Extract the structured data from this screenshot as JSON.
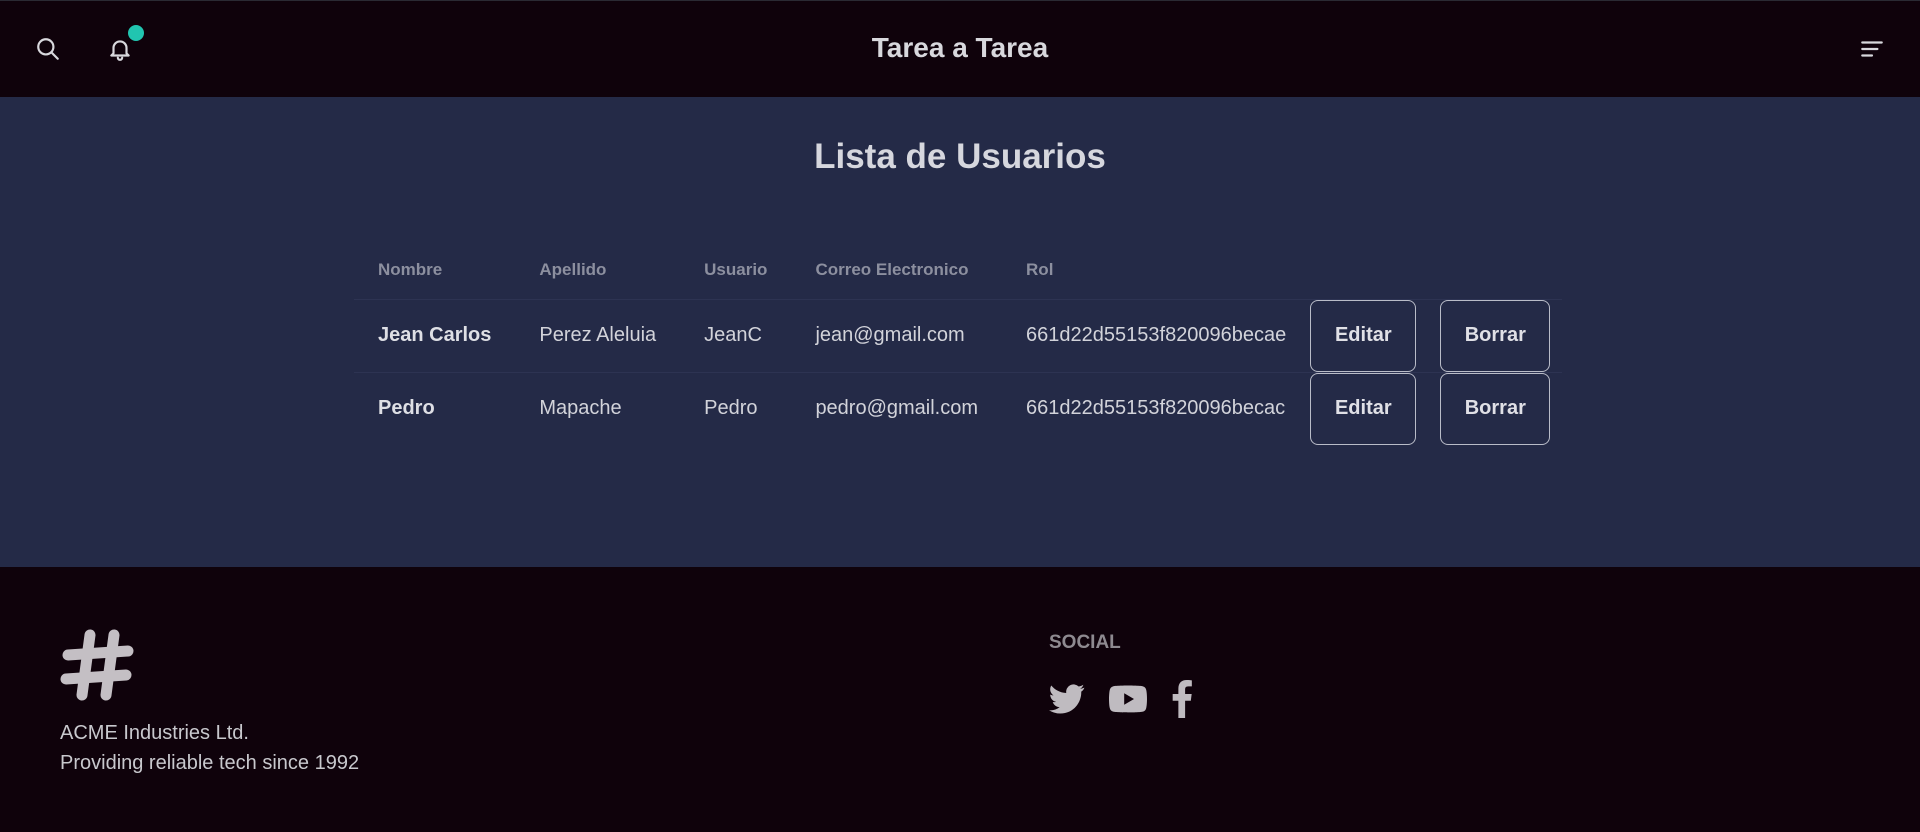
{
  "navbar": {
    "brand": "Tarea a Tarea",
    "icons": [
      "search-icon",
      "bell-icon",
      "menu-icon"
    ],
    "badge_color": "#21c5b0"
  },
  "main": {
    "title": "Lista de Usuarios",
    "columns": [
      "Nombre",
      "Apellido",
      "Usuario",
      "Correo Electronico",
      "Rol"
    ],
    "rows": [
      {
        "nombre": "Jean Carlos",
        "apellido": "Perez Aleluia",
        "usuario": "JeanC",
        "correo": "jean@gmail.com",
        "rol": "661d22d55153f820096becae",
        "edit_label": "Editar",
        "delete_label": "Borrar"
      },
      {
        "nombre": "Pedro",
        "apellido": "Mapache",
        "usuario": "Pedro",
        "correo": "pedro@gmail.com",
        "rol": "661d22d55153f820096becac",
        "edit_label": "Editar",
        "delete_label": "Borrar"
      }
    ]
  },
  "footer": {
    "company_name": "ACME Industries Ltd.",
    "tagline": "Providing reliable tech since 1992",
    "social_title": "SOCIAL",
    "social_icons": [
      "twitter-icon",
      "youtube-icon",
      "facebook-icon"
    ]
  },
  "colors": {
    "navbar_bg": "#0f020b",
    "main_bg": "#242a47",
    "footer_bg": "#0f020b",
    "accent": "#21c5b0"
  }
}
